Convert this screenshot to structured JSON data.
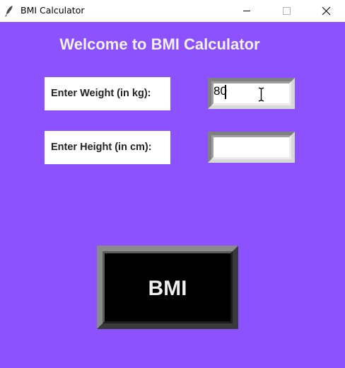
{
  "window": {
    "title": "BMI Calculator",
    "icon": "feather-icon"
  },
  "controls": {
    "minimize_icon": "minimize-icon",
    "maximize_icon": "maximize-icon",
    "close_icon": "close-icon"
  },
  "main": {
    "heading": "Welcome to BMI Calculator",
    "weight_label": "Enter Weight (in kg):",
    "weight_value": "80",
    "height_label": "Enter Height (in cm):",
    "height_value": "",
    "bmi_button_label": "BMI"
  },
  "colors": {
    "background": "#8c52ff",
    "button_bg": "#000000",
    "heading_text": "#f2f2f2"
  }
}
